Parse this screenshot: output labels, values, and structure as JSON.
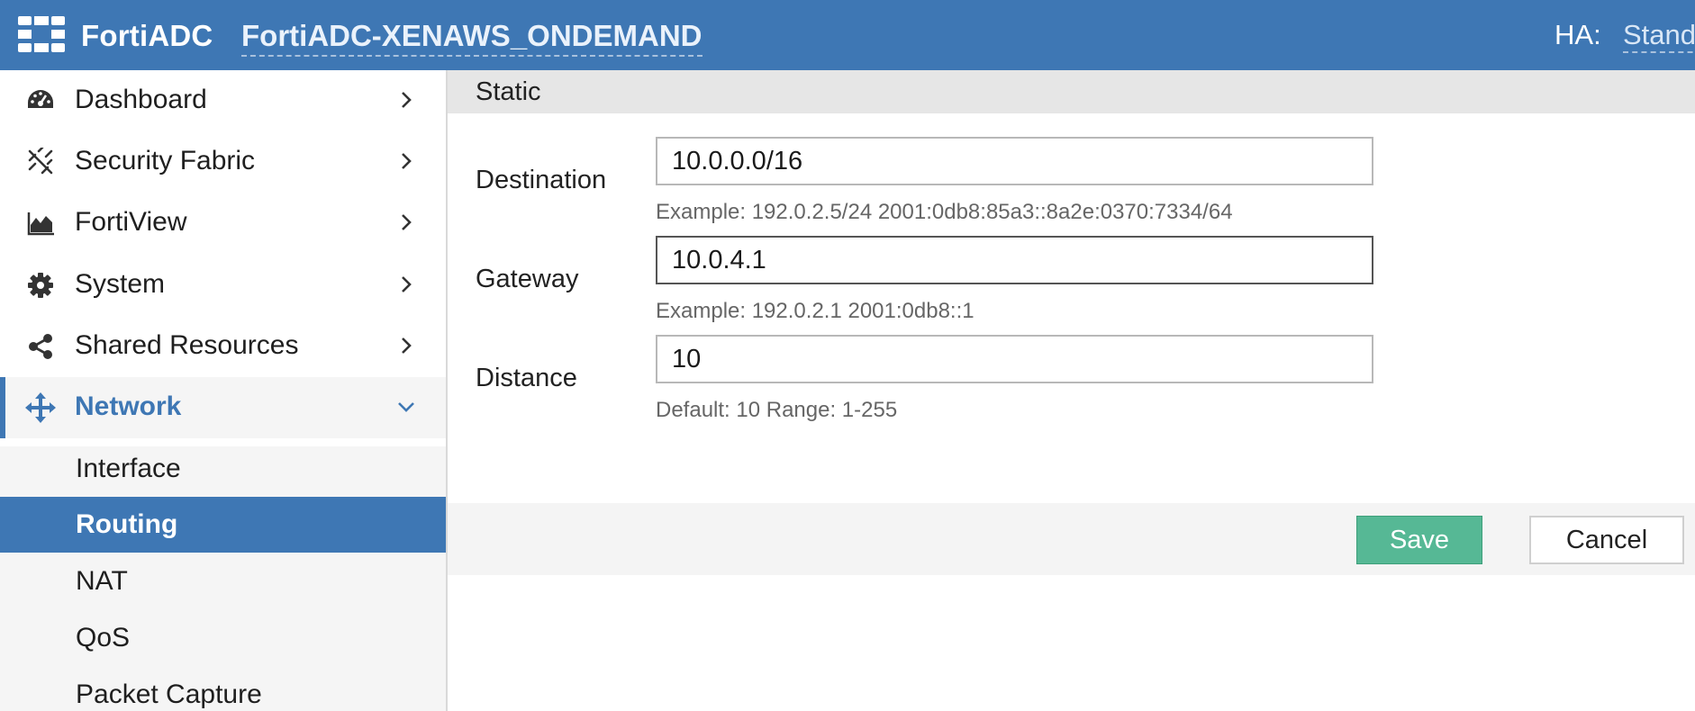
{
  "topbar": {
    "logo": "fortinet-grid-logo",
    "brand": "FortiADC",
    "hostname": "FortiADC-XENAWS_ONDEMAND",
    "ha_label": "HA:",
    "ha_value": "Standa"
  },
  "sidebar": {
    "items": [
      {
        "label": "Dashboard",
        "icon": "dashboard-gauge-icon"
      },
      {
        "label": "Security Fabric",
        "icon": "security-fabric-icon"
      },
      {
        "label": "FortiView",
        "icon": "area-chart-icon"
      },
      {
        "label": "System",
        "icon": "gear-icon"
      },
      {
        "label": "Shared Resources",
        "icon": "share-icon"
      },
      {
        "label": "Network",
        "icon": "move-arrows-icon",
        "expanded": true
      }
    ],
    "network_sub": [
      {
        "label": "Interface"
      },
      {
        "label": "Routing",
        "selected": true
      },
      {
        "label": "NAT"
      },
      {
        "label": "QoS"
      },
      {
        "label": "Packet Capture"
      }
    ]
  },
  "main": {
    "section_title": "Static",
    "fields": {
      "destination": {
        "label": "Destination",
        "value": "10.0.0.0/16",
        "hint": "Example: 192.0.2.5/24 2001:0db8:85a3::8a2e:0370:7334/64"
      },
      "gateway": {
        "label": "Gateway",
        "value": "10.0.4.1",
        "hint": "Example: 192.0.2.1 2001:0db8::1"
      },
      "distance": {
        "label": "Distance",
        "value": "10",
        "hint": "Default: 10 Range: 1-255"
      }
    },
    "buttons": {
      "save": "Save",
      "cancel": "Cancel"
    }
  },
  "colors": {
    "brand_blue": "#3e77b4",
    "save_green": "#56b895",
    "sidebar_sub_bg": "#f5f5f5",
    "section_header_bg": "#e6e6e6"
  }
}
